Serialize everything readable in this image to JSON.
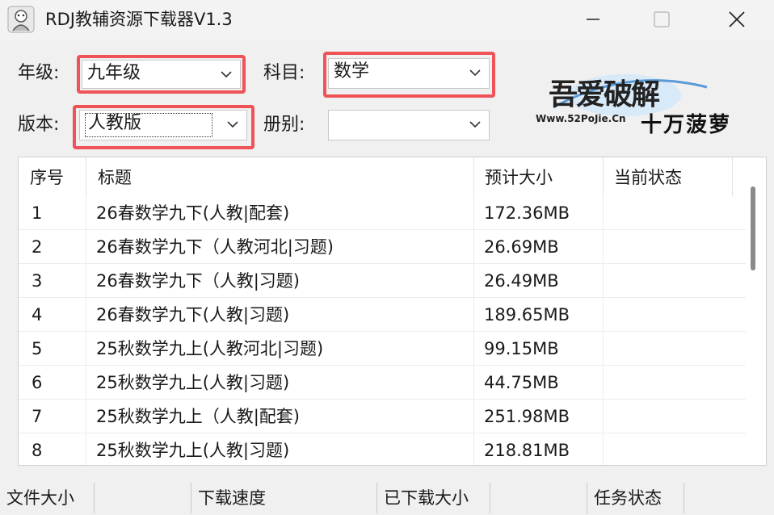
{
  "window": {
    "title": "RDJ教辅资源下载器V1.3"
  },
  "filters": {
    "grade_label": "年级:",
    "grade_value": "九年级",
    "subject_label": "科目:",
    "subject_value": "数学",
    "edition_label": "版本:",
    "edition_value": "人教版",
    "volume_label": "册别:",
    "volume_value": ""
  },
  "logo": {
    "brand_text": "吾爱破解",
    "url_text": "Www.52PoJie.Cn",
    "author_text": "十万菠萝"
  },
  "table": {
    "headers": [
      "序号",
      "标题",
      "预计大小",
      "当前状态"
    ],
    "rows": [
      {
        "no": "1",
        "title": "26春数学九下(人教|配套)",
        "size": "172.36MB",
        "status": ""
      },
      {
        "no": "2",
        "title": "26春数学九下（人教河北|习题)",
        "size": "26.69MB",
        "status": ""
      },
      {
        "no": "3",
        "title": "26春数学九下（人教|习题)",
        "size": "26.49MB",
        "status": ""
      },
      {
        "no": "4",
        "title": "26春数学九下(人教|习题)",
        "size": "189.65MB",
        "status": ""
      },
      {
        "no": "5",
        "title": "25秋数学九上(人教河北|习题)",
        "size": "99.15MB",
        "status": ""
      },
      {
        "no": "6",
        "title": "25秋数学九上(人教|习题)",
        "size": "44.75MB",
        "status": ""
      },
      {
        "no": "7",
        "title": "25秋数学九上（人教|配套)",
        "size": "251.98MB",
        "status": ""
      },
      {
        "no": "8",
        "title": "25秋数学九上(人教|习题)",
        "size": "218.81MB",
        "status": ""
      }
    ]
  },
  "statusbar": {
    "file_size": "文件大小",
    "speed": "下载速度",
    "downloaded": "已下载大小",
    "task_status": "任务状态"
  },
  "colors": {
    "highlight": "#ef5358",
    "logo_blue": "#2a78c8"
  }
}
